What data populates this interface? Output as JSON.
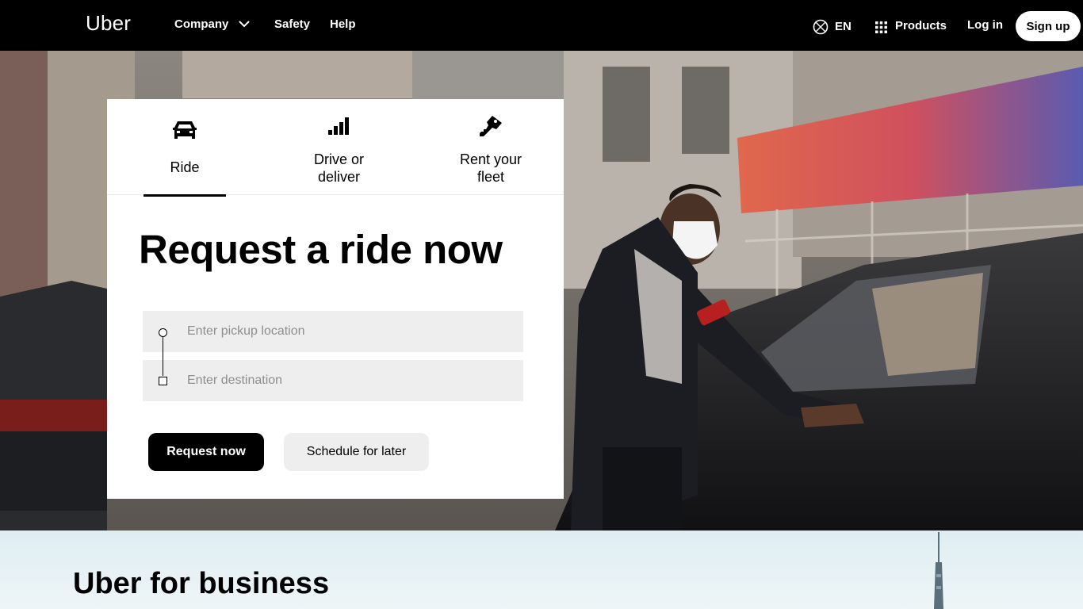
{
  "header": {
    "logo": "Uber",
    "nav": {
      "company": "Company",
      "safety": "Safety",
      "help": "Help"
    },
    "language": "EN",
    "products": "Products",
    "login": "Log in",
    "signup": "Sign up"
  },
  "card": {
    "tabs": [
      {
        "label": "Ride",
        "icon": "car-icon",
        "active": true
      },
      {
        "label": "Drive or\ndeliver",
        "icon": "signal-bars-icon",
        "active": false
      },
      {
        "label": "Rent your\nfleet",
        "icon": "key-icon",
        "active": false
      }
    ],
    "title": "Request a ride now",
    "pickup": {
      "placeholder": "Enter pickup location",
      "value": ""
    },
    "destination": {
      "placeholder": "Enter destination",
      "value": ""
    },
    "request_button": "Request now",
    "schedule_button": "Schedule for later"
  },
  "business": {
    "title": "Uber for business"
  },
  "colors": {
    "nav_bg": "#000000",
    "primary_button_bg": "#000000",
    "secondary_button_bg": "#eeeeee",
    "input_bg": "#eeeeee",
    "business_bg": "#e6f1f4"
  }
}
